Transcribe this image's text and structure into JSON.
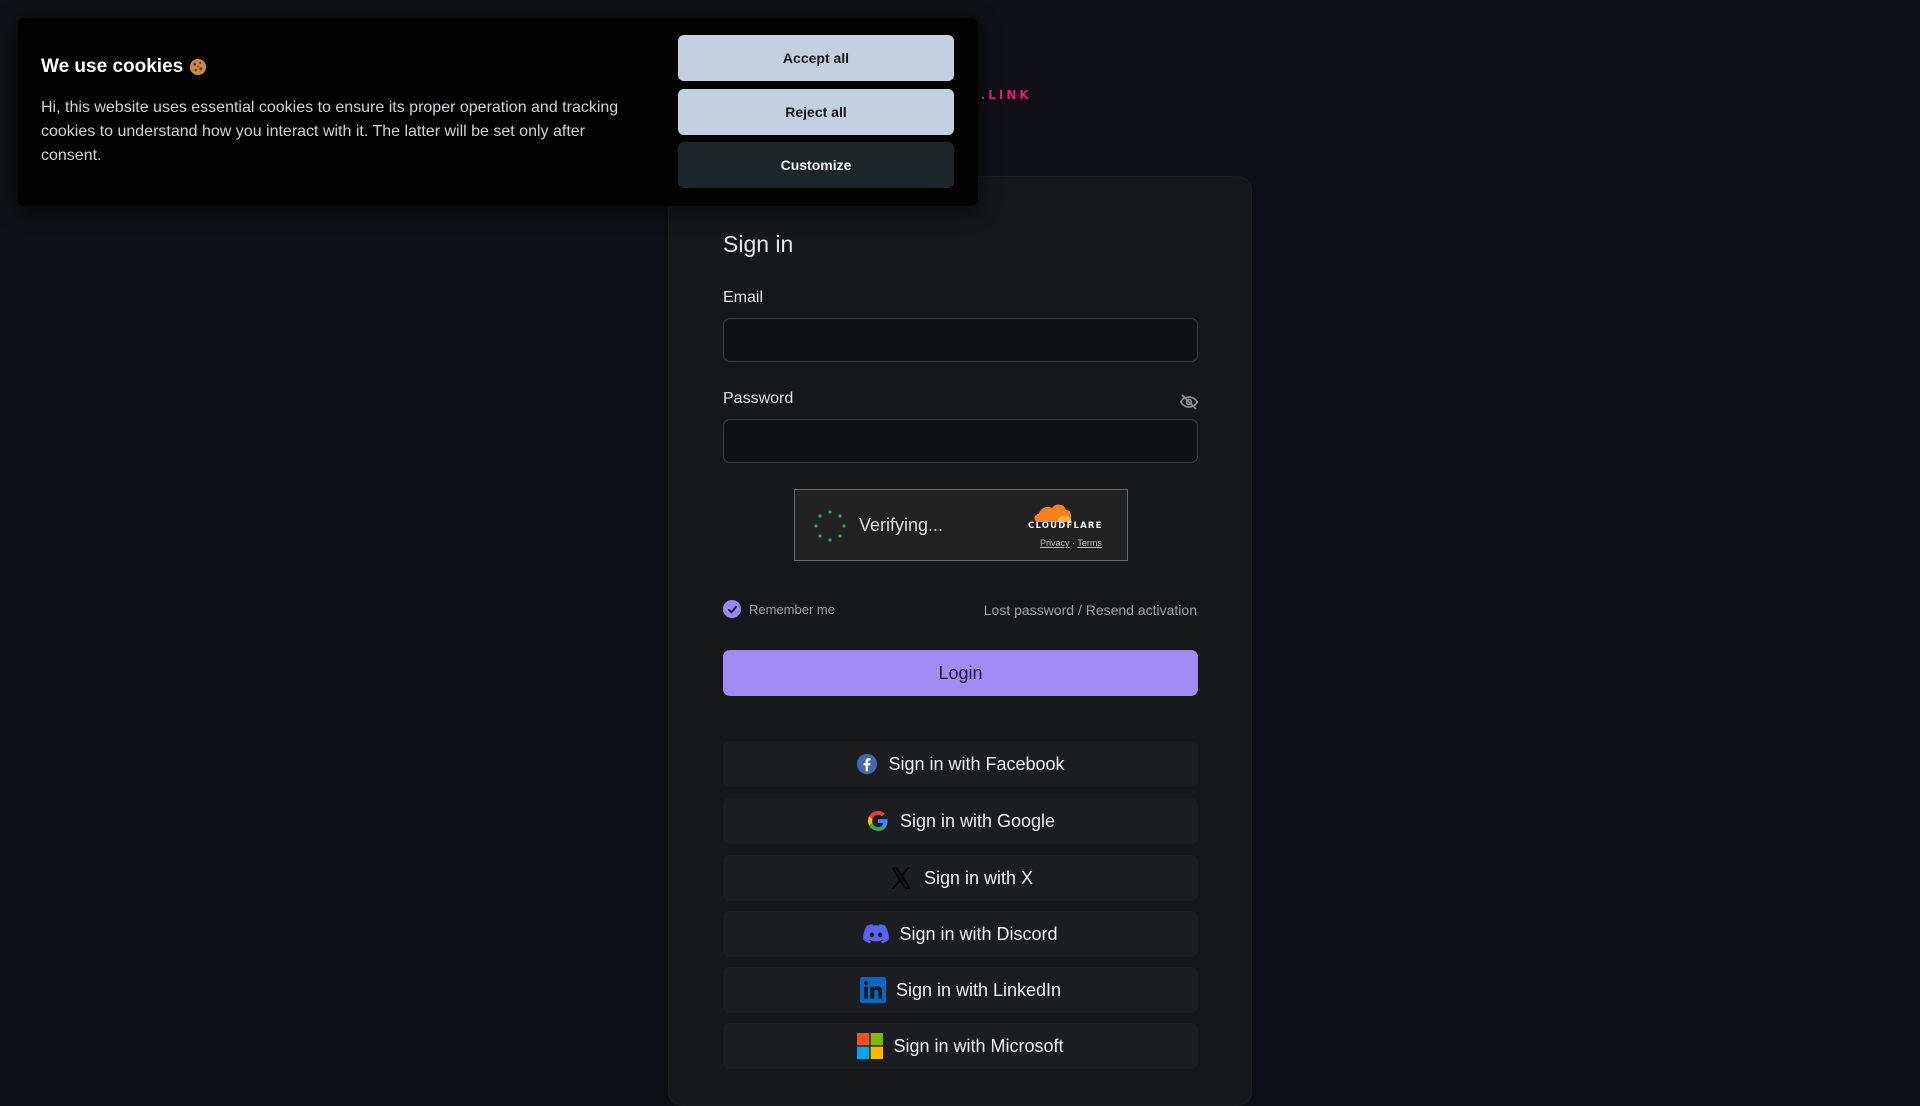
{
  "logo": {
    "visible_text": "S.LINK"
  },
  "signin": {
    "title": "Sign in",
    "email_label": "Email",
    "email_value": "",
    "password_label": "Password",
    "password_value": "",
    "remember_label": "Remember me",
    "remember_checked": true,
    "lost_password_link": "Lost password / Resend activation",
    "login_button": "Login"
  },
  "turnstile": {
    "status": "Verifying...",
    "brand": "CLOUDFLARE",
    "privacy": "Privacy",
    "separator": "·",
    "terms": "Terms"
  },
  "social": [
    {
      "id": "facebook",
      "label": "Sign in with Facebook",
      "icon": "facebook-icon"
    },
    {
      "id": "google",
      "label": "Sign in with Google",
      "icon": "google-icon"
    },
    {
      "id": "x",
      "label": "Sign in with X",
      "icon": "x-icon"
    },
    {
      "id": "discord",
      "label": "Sign in with Discord",
      "icon": "discord-icon"
    },
    {
      "id": "linkedin",
      "label": "Sign in with LinkedIn",
      "icon": "linkedin-icon"
    },
    {
      "id": "microsoft",
      "label": "Sign in with Microsoft",
      "icon": "microsoft-icon"
    }
  ],
  "cookie": {
    "title": "We use cookies",
    "text": "Hi, this website uses essential cookies to ensure its proper operation and tracking cookies to understand how you interact with it. The latter will be set only after consent.",
    "accept_label": "Accept all",
    "reject_label": "Reject all",
    "customize_label": "Customize"
  },
  "colors": {
    "background": "#0e1015",
    "card": "#151719",
    "accent": "#a18cf5",
    "logo": "#e11d74"
  }
}
